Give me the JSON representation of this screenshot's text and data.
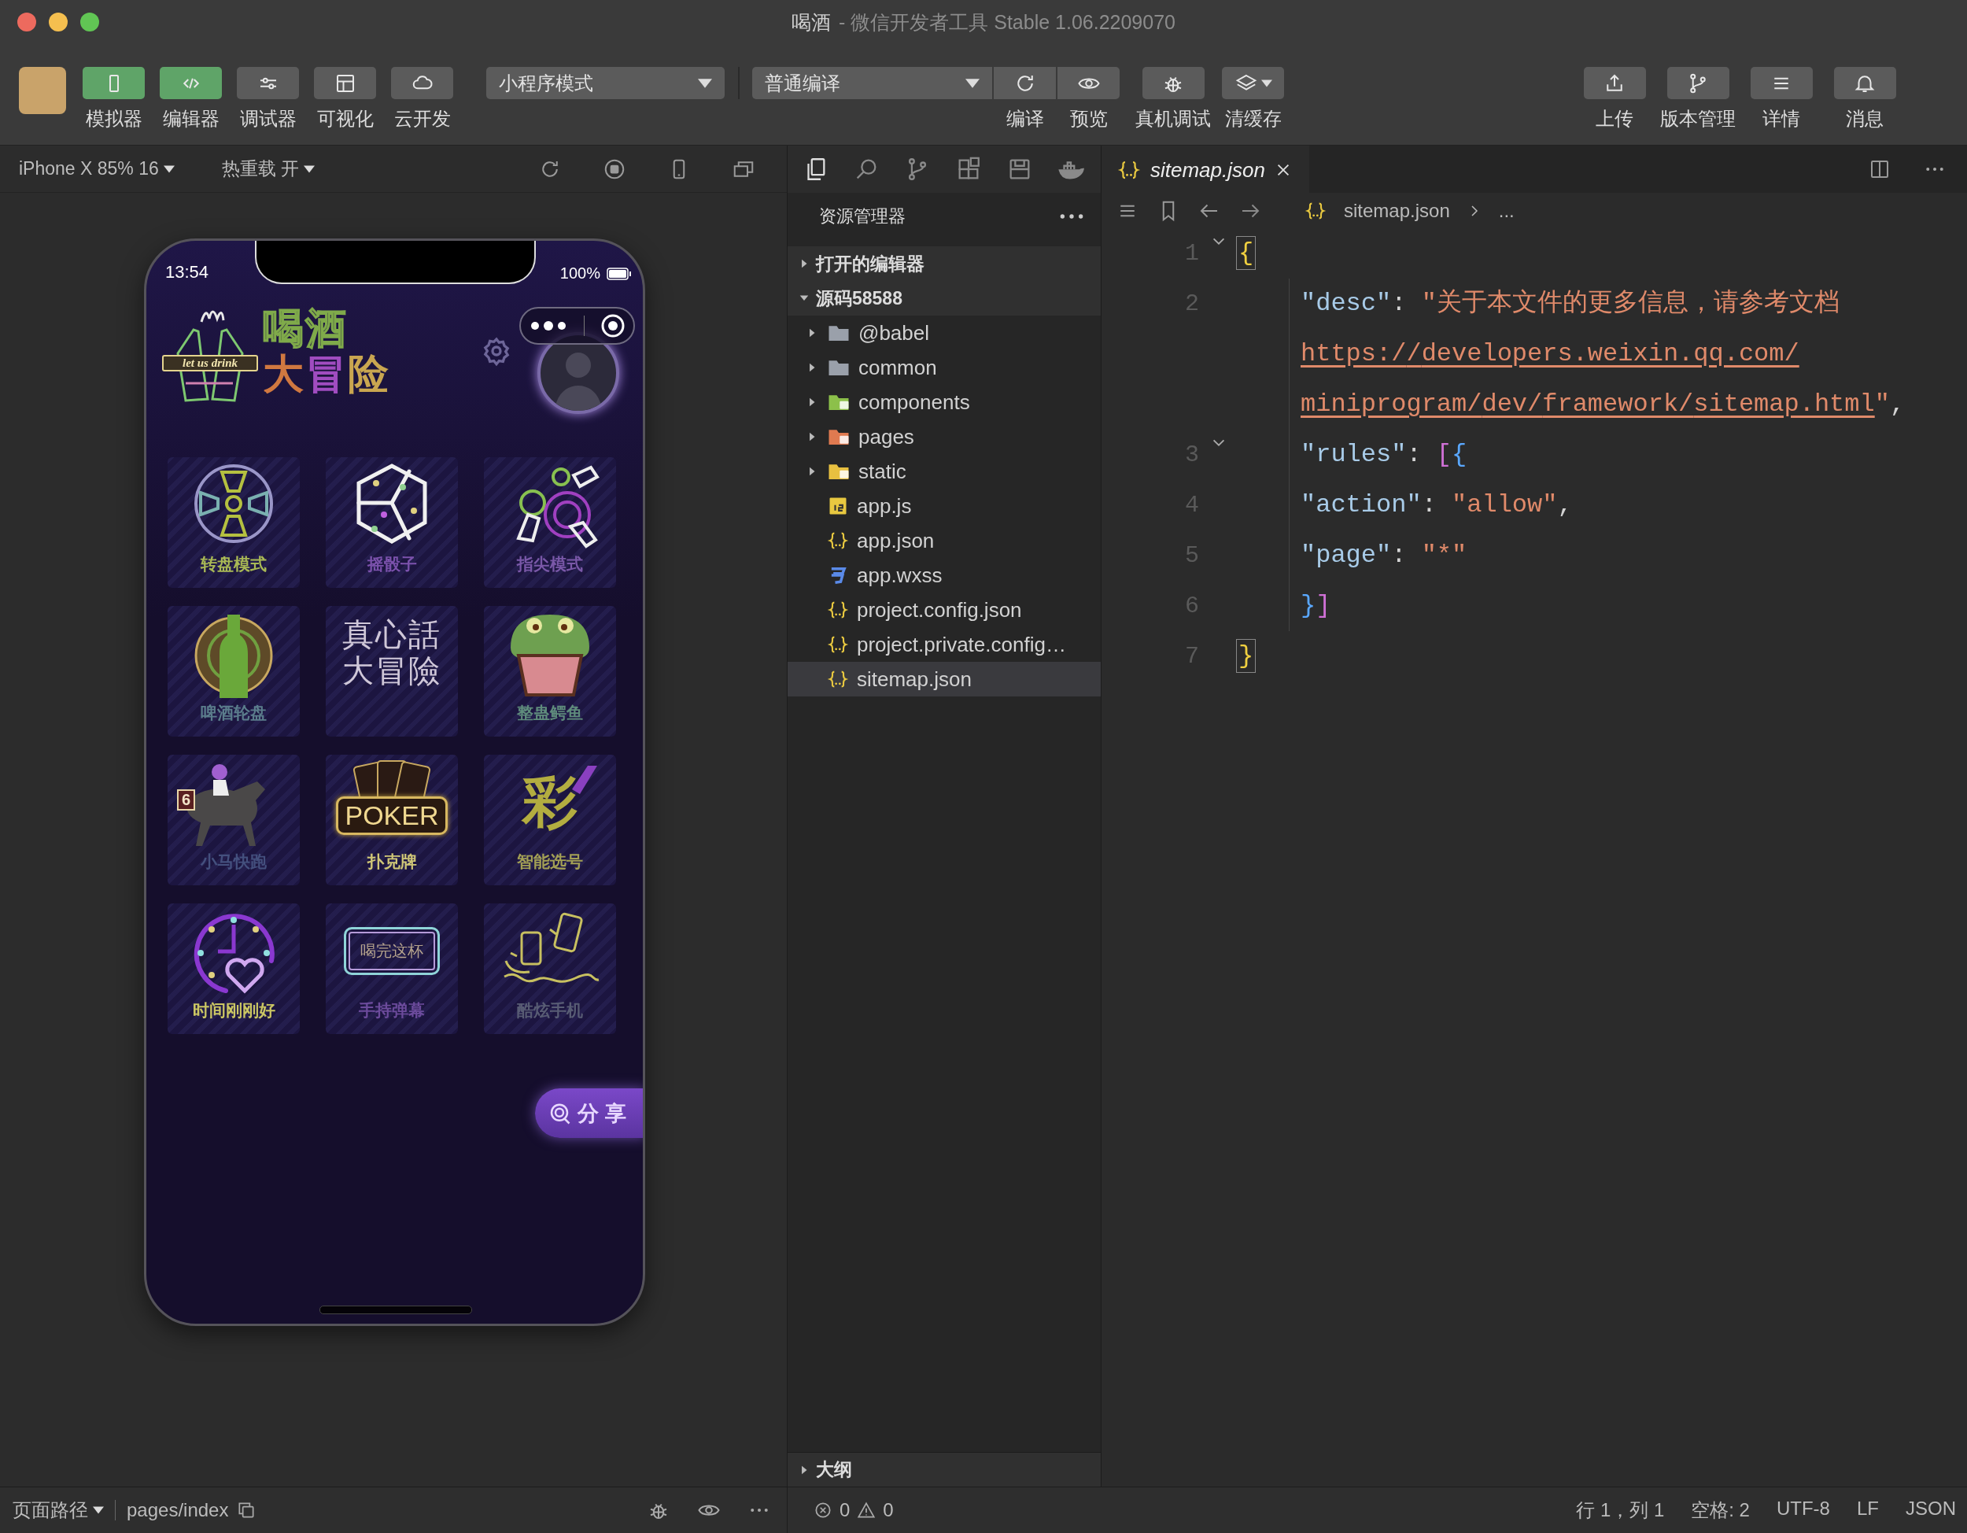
{
  "window": {
    "project": "喝酒",
    "title": "- 微信开发者工具 Stable 1.06.2209070"
  },
  "toolbar": {
    "view_buttons": [
      {
        "label": "模拟器",
        "on": true
      },
      {
        "label": "编辑器",
        "on": true
      },
      {
        "label": "调试器",
        "on": false
      },
      {
        "label": "可视化",
        "on": false
      },
      {
        "label": "云开发",
        "on": false
      }
    ],
    "mode_select": "小程序模式",
    "compile_select": "普通编译",
    "compile_buttons": [
      {
        "label": "编译"
      },
      {
        "label": "预览"
      }
    ],
    "tool_buttons": [
      {
        "label": "真机调试",
        "has_menu": false
      },
      {
        "label": "清缓存",
        "has_menu": true
      }
    ],
    "right_buttons": [
      {
        "label": "上传"
      },
      {
        "label": "版本管理"
      },
      {
        "label": "详情"
      },
      {
        "label": "消息"
      }
    ]
  },
  "simulator": {
    "device": "iPhone X 85% 16",
    "hot_reload": "热重载 开",
    "phone": {
      "time": "13:54",
      "battery": "100%",
      "logo_text": "let us drink",
      "title_lines": [
        "喝酒",
        "大冒险"
      ],
      "tiles": [
        {
          "kind": "wheel",
          "label": "转盘模式",
          "color": "#a9b955"
        },
        {
          "kind": "dice",
          "label": "摇骰子",
          "color": "#7c52ad"
        },
        {
          "kind": "fingers",
          "label": "指尖模式",
          "color": "#7a58a8"
        },
        {
          "kind": "roulette",
          "label": "啤酒轮盘",
          "color": "#5b7d8c"
        },
        {
          "kind": "textart",
          "art_text": "真心話大冒險"
        },
        {
          "kind": "croc",
          "label": "整蛊鳄鱼",
          "color": "#5f8c7c"
        },
        {
          "kind": "horse",
          "art_text": "6",
          "label": "小马快跑",
          "color": "#44507e"
        },
        {
          "kind": "poker",
          "art_text": "POKER",
          "label": "扑克牌",
          "color": "#cfc677"
        },
        {
          "kind": "lottery",
          "art_text": "彩",
          "label": "智能选号",
          "color": "#a3a055"
        },
        {
          "kind": "clock",
          "label": "时间刚刚好",
          "color": "#cbc663"
        },
        {
          "kind": "phone",
          "art_text": "喝完这杯",
          "label": "手持弹幕",
          "color": "#6c4b9c"
        },
        {
          "kind": "phones",
          "label": "酷炫手机",
          "color": "#585c74"
        }
      ],
      "share_button": "分享"
    }
  },
  "explorer": {
    "title": "资源管理器",
    "sections": [
      {
        "label": "打开的编辑器",
        "expanded": false
      },
      {
        "label": "源码58588",
        "expanded": true,
        "children": [
          {
            "kind": "folder",
            "name": "@babel",
            "expanded": false,
            "selected": false
          },
          {
            "kind": "folder",
            "name": "common",
            "expanded": false,
            "selected": false
          },
          {
            "kind": "components",
            "name": "components",
            "expanded": false,
            "selected": false
          },
          {
            "kind": "pages",
            "name": "pages",
            "expanded": false,
            "selected": false
          },
          {
            "kind": "static",
            "name": "static",
            "expanded": false,
            "selected": false
          },
          {
            "kind": "js",
            "name": "app.js",
            "selected": false
          },
          {
            "kind": "json",
            "name": "app.json",
            "selected": false
          },
          {
            "kind": "wxss",
            "name": "app.wxss",
            "selected": false
          },
          {
            "kind": "json",
            "name": "project.config.json",
            "selected": false
          },
          {
            "kind": "json",
            "name": "project.private.config…",
            "selected": false
          },
          {
            "kind": "json",
            "name": "sitemap.json",
            "selected": true
          }
        ]
      }
    ],
    "outline": {
      "label": "大纲",
      "expanded": false
    }
  },
  "editor": {
    "tab": {
      "title": "sitemap.json",
      "selected": true
    },
    "breadcrumb": [
      "sitemap.json",
      "..."
    ],
    "lines": [
      {
        "number": "1",
        "foldable": true,
        "indented": false,
        "bracket_match": true,
        "tokens": [
          {
            "kind": "brace",
            "text": "{"
          }
        ]
      },
      {
        "number": "2",
        "foldable": false,
        "indented": true,
        "bracket_match": false,
        "tokens": [
          {
            "kind": "key",
            "text": "\"desc\""
          },
          {
            "kind": "punct",
            "text": ": "
          },
          {
            "kind": "string",
            "text": "\"关于本文件的更多信息，请参考文档"
          },
          {
            "kind": "link",
            "text": "https://developers.weixin.qq.com/miniprogram/dev/framework/sitemap.html"
          },
          {
            "kind": "string",
            "text": "\""
          },
          {
            "kind": "punct",
            "text": ","
          }
        ]
      },
      {
        "number": "3",
        "foldable": true,
        "indented": true,
        "bracket_match": false,
        "tokens": [
          {
            "kind": "key",
            "text": "\"rules\""
          },
          {
            "kind": "punct",
            "text": ": "
          },
          {
            "kind": "bracket",
            "text": "["
          },
          {
            "kind": "inner",
            "text": "{"
          }
        ]
      },
      {
        "number": "4",
        "foldable": false,
        "indented": true,
        "bracket_match": false,
        "tokens": [
          {
            "kind": "key",
            "text": "\"action\""
          },
          {
            "kind": "punct",
            "text": ": "
          },
          {
            "kind": "string",
            "text": "\"allow\""
          },
          {
            "kind": "punct",
            "text": ","
          }
        ]
      },
      {
        "number": "5",
        "foldable": false,
        "indented": true,
        "bracket_match": false,
        "tokens": [
          {
            "kind": "key",
            "text": "\"page\""
          },
          {
            "kind": "punct",
            "text": ": "
          },
          {
            "kind": "string",
            "text": "\"*\""
          }
        ]
      },
      {
        "number": "6",
        "foldable": false,
        "indented": true,
        "bracket_match": false,
        "tokens": [
          {
            "kind": "inner",
            "text": "}"
          },
          {
            "kind": "bracket",
            "text": "]"
          }
        ]
      },
      {
        "number": "7",
        "foldable": false,
        "indented": false,
        "bracket_match": true,
        "tokens": [
          {
            "kind": "brace",
            "text": "}"
          }
        ]
      }
    ]
  },
  "status_bar": {
    "page_path_label": "页面路径",
    "page_path": "pages/index",
    "errors": "0",
    "warnings": "0",
    "items": [
      "行 1，列 1",
      "空格: 2",
      "UTF-8",
      "LF",
      "JSON"
    ]
  }
}
